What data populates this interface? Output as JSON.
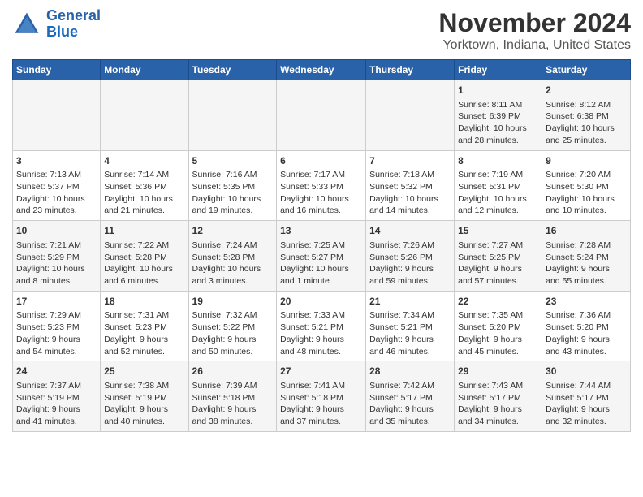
{
  "logo": {
    "line1": "General",
    "line2": "Blue"
  },
  "title": "November 2024",
  "subtitle": "Yorktown, Indiana, United States",
  "weekdays": [
    "Sunday",
    "Monday",
    "Tuesday",
    "Wednesday",
    "Thursday",
    "Friday",
    "Saturday"
  ],
  "weeks": [
    [
      {
        "day": "",
        "info": ""
      },
      {
        "day": "",
        "info": ""
      },
      {
        "day": "",
        "info": ""
      },
      {
        "day": "",
        "info": ""
      },
      {
        "day": "",
        "info": ""
      },
      {
        "day": "1",
        "info": "Sunrise: 8:11 AM\nSunset: 6:39 PM\nDaylight: 10 hours\nand 28 minutes."
      },
      {
        "day": "2",
        "info": "Sunrise: 8:12 AM\nSunset: 6:38 PM\nDaylight: 10 hours\nand 25 minutes."
      }
    ],
    [
      {
        "day": "3",
        "info": "Sunrise: 7:13 AM\nSunset: 5:37 PM\nDaylight: 10 hours\nand 23 minutes."
      },
      {
        "day": "4",
        "info": "Sunrise: 7:14 AM\nSunset: 5:36 PM\nDaylight: 10 hours\nand 21 minutes."
      },
      {
        "day": "5",
        "info": "Sunrise: 7:16 AM\nSunset: 5:35 PM\nDaylight: 10 hours\nand 19 minutes."
      },
      {
        "day": "6",
        "info": "Sunrise: 7:17 AM\nSunset: 5:33 PM\nDaylight: 10 hours\nand 16 minutes."
      },
      {
        "day": "7",
        "info": "Sunrise: 7:18 AM\nSunset: 5:32 PM\nDaylight: 10 hours\nand 14 minutes."
      },
      {
        "day": "8",
        "info": "Sunrise: 7:19 AM\nSunset: 5:31 PM\nDaylight: 10 hours\nand 12 minutes."
      },
      {
        "day": "9",
        "info": "Sunrise: 7:20 AM\nSunset: 5:30 PM\nDaylight: 10 hours\nand 10 minutes."
      }
    ],
    [
      {
        "day": "10",
        "info": "Sunrise: 7:21 AM\nSunset: 5:29 PM\nDaylight: 10 hours\nand 8 minutes."
      },
      {
        "day": "11",
        "info": "Sunrise: 7:22 AM\nSunset: 5:28 PM\nDaylight: 10 hours\nand 6 minutes."
      },
      {
        "day": "12",
        "info": "Sunrise: 7:24 AM\nSunset: 5:28 PM\nDaylight: 10 hours\nand 3 minutes."
      },
      {
        "day": "13",
        "info": "Sunrise: 7:25 AM\nSunset: 5:27 PM\nDaylight: 10 hours\nand 1 minute."
      },
      {
        "day": "14",
        "info": "Sunrise: 7:26 AM\nSunset: 5:26 PM\nDaylight: 9 hours\nand 59 minutes."
      },
      {
        "day": "15",
        "info": "Sunrise: 7:27 AM\nSunset: 5:25 PM\nDaylight: 9 hours\nand 57 minutes."
      },
      {
        "day": "16",
        "info": "Sunrise: 7:28 AM\nSunset: 5:24 PM\nDaylight: 9 hours\nand 55 minutes."
      }
    ],
    [
      {
        "day": "17",
        "info": "Sunrise: 7:29 AM\nSunset: 5:23 PM\nDaylight: 9 hours\nand 54 minutes."
      },
      {
        "day": "18",
        "info": "Sunrise: 7:31 AM\nSunset: 5:23 PM\nDaylight: 9 hours\nand 52 minutes."
      },
      {
        "day": "19",
        "info": "Sunrise: 7:32 AM\nSunset: 5:22 PM\nDaylight: 9 hours\nand 50 minutes."
      },
      {
        "day": "20",
        "info": "Sunrise: 7:33 AM\nSunset: 5:21 PM\nDaylight: 9 hours\nand 48 minutes."
      },
      {
        "day": "21",
        "info": "Sunrise: 7:34 AM\nSunset: 5:21 PM\nDaylight: 9 hours\nand 46 minutes."
      },
      {
        "day": "22",
        "info": "Sunrise: 7:35 AM\nSunset: 5:20 PM\nDaylight: 9 hours\nand 45 minutes."
      },
      {
        "day": "23",
        "info": "Sunrise: 7:36 AM\nSunset: 5:20 PM\nDaylight: 9 hours\nand 43 minutes."
      }
    ],
    [
      {
        "day": "24",
        "info": "Sunrise: 7:37 AM\nSunset: 5:19 PM\nDaylight: 9 hours\nand 41 minutes."
      },
      {
        "day": "25",
        "info": "Sunrise: 7:38 AM\nSunset: 5:19 PM\nDaylight: 9 hours\nand 40 minutes."
      },
      {
        "day": "26",
        "info": "Sunrise: 7:39 AM\nSunset: 5:18 PM\nDaylight: 9 hours\nand 38 minutes."
      },
      {
        "day": "27",
        "info": "Sunrise: 7:41 AM\nSunset: 5:18 PM\nDaylight: 9 hours\nand 37 minutes."
      },
      {
        "day": "28",
        "info": "Sunrise: 7:42 AM\nSunset: 5:17 PM\nDaylight: 9 hours\nand 35 minutes."
      },
      {
        "day": "29",
        "info": "Sunrise: 7:43 AM\nSunset: 5:17 PM\nDaylight: 9 hours\nand 34 minutes."
      },
      {
        "day": "30",
        "info": "Sunrise: 7:44 AM\nSunset: 5:17 PM\nDaylight: 9 hours\nand 32 minutes."
      }
    ]
  ]
}
